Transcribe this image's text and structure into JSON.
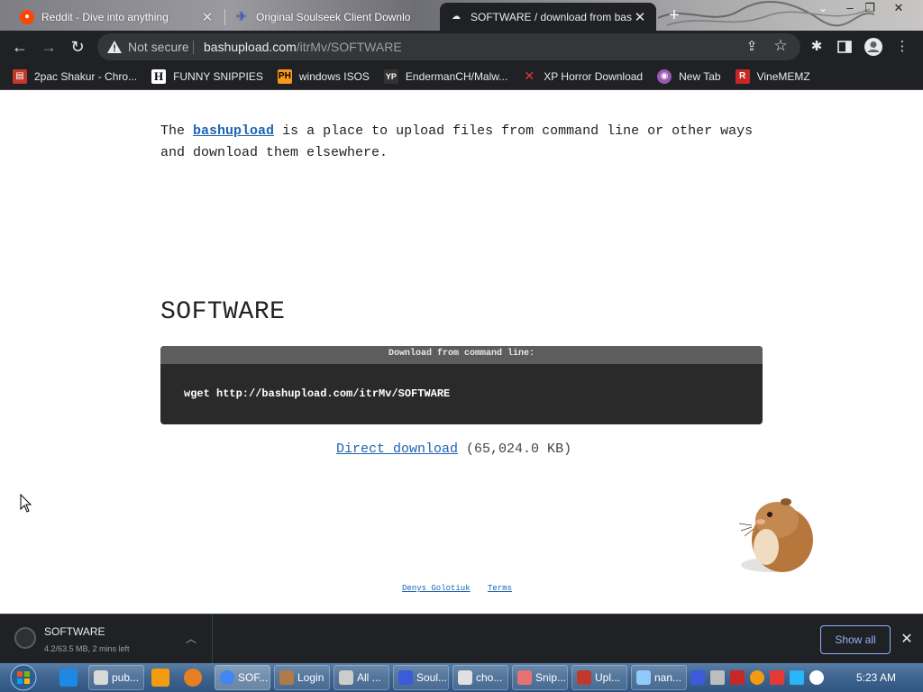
{
  "browser": {
    "tabs": [
      {
        "title": "Reddit - Dive into anything",
        "state": "inactive",
        "favicon_color": "#ff4500"
      },
      {
        "title": "Original Soulseek Client Downlo",
        "state": "inactive",
        "favicon_color": "#3b5bdb"
      },
      {
        "title": "SOFTWARE / download from bas",
        "state": "active",
        "favicon_color": "#e8eaed"
      }
    ],
    "new_tab_symbol": "+",
    "window_controls": {
      "minimize": "–",
      "restore": "❐",
      "close": "✕"
    },
    "security_label": "Not secure",
    "url_host": "bashupload.com",
    "url_path": "/itrMv/SOFTWARE",
    "bookmarks": [
      {
        "label": "2pac Shakur - Chro...",
        "icon": "bookmark-2pac-icon",
        "color": "#c0392b"
      },
      {
        "label": "FUNNY SNIPPIES",
        "icon": "letter-h-icon",
        "color": "#ffffff"
      },
      {
        "label": "windows ISOS",
        "icon": "ph-icon",
        "color": "#f7971d"
      },
      {
        "label": "EndermanCH/Malw...",
        "icon": "yp-icon",
        "color": "#333333"
      },
      {
        "label": "XP Horror Download",
        "icon": "x-icon",
        "color": "#e53935"
      },
      {
        "label": "New Tab",
        "icon": "globe-icon",
        "color": "#9b59b6"
      },
      {
        "label": "VineMEMZ",
        "icon": "r-icon",
        "color": "#c62828"
      }
    ]
  },
  "page": {
    "intro_prefix": "The",
    "intro_link": "bashupload",
    "intro_suffix": "is a place to upload files from command line or other ways and download them elsewhere.",
    "file_title": "SOFTWARE",
    "command_header": "Download from command line:",
    "command": "wget http://bashupload.com/itrMv/SOFTWARE",
    "direct_download_label": "Direct download",
    "file_size": "(65,024.0 KB)",
    "footer_links": [
      "Denys Golotiuk",
      "Terms"
    ]
  },
  "downloads": {
    "file_name": "SOFTWARE",
    "progress_text": "4.2/63.5 MB, 2 mins left",
    "show_all_label": "Show all"
  },
  "taskbar": {
    "items": [
      {
        "label": "pub...",
        "color": "#d9d9d9"
      },
      {
        "label": "SOF...",
        "color": "#4285f4",
        "active": true
      },
      {
        "label": "Login",
        "color": "#b07a4a"
      },
      {
        "label": "All ...",
        "color": "#cccccc"
      },
      {
        "label": "Soul...",
        "color": "#3b5bdb"
      },
      {
        "label": "cho...",
        "color": "#e0e0e0"
      },
      {
        "label": "Snip...",
        "color": "#e57373"
      },
      {
        "label": "Upl...",
        "color": "#c0392b"
      },
      {
        "label": "nan...",
        "color": "#90caf9"
      }
    ],
    "clock": "5:23 AM"
  }
}
